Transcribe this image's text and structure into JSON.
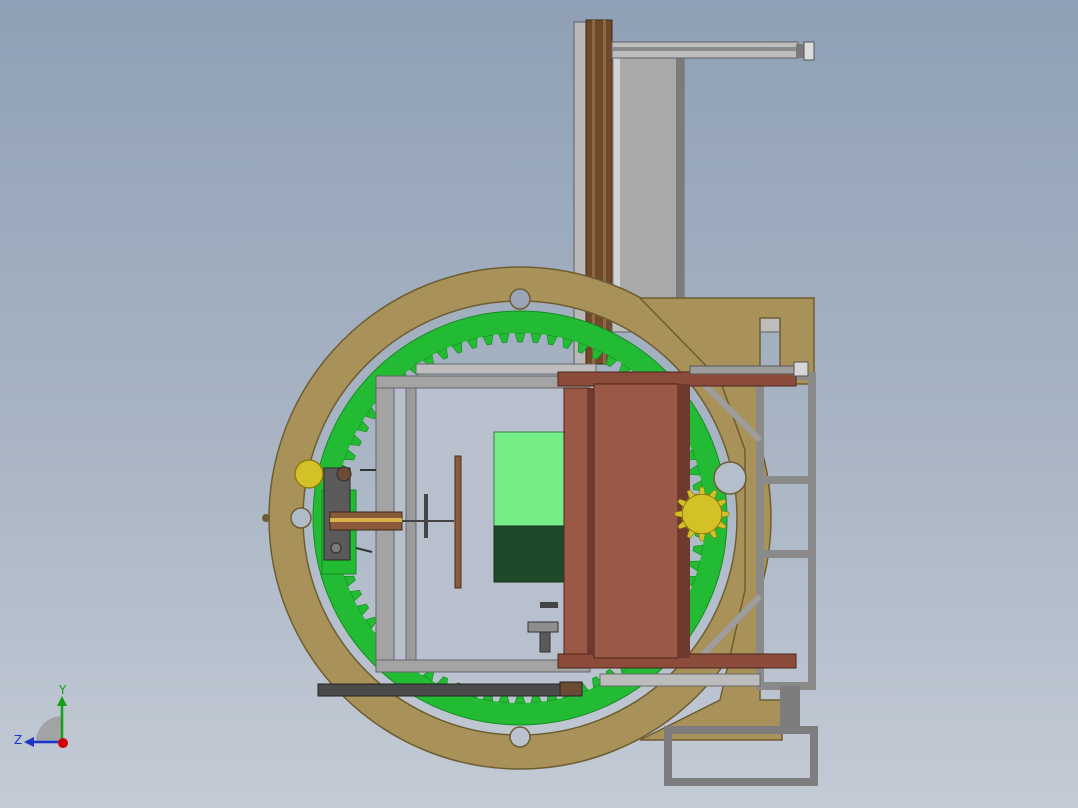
{
  "view": {
    "type": "cad-assembly-view",
    "background_top": "#8fa0b6",
    "background_bottom": "#c3cbd5"
  },
  "colors": {
    "ring_tan": "#a99259",
    "ring_tan_light": "#bca86e",
    "gear_green": "#22bb33",
    "gear_green_dark": "#178a23",
    "frame_gray": "#8e8e8e",
    "frame_light": "#c6c6c6",
    "plate_brown": "#9a5847",
    "plate_brown_dark": "#6e3a2e",
    "rail_wood": "#6f4a2a",
    "panel_light_green": "#76ee87",
    "panel_dark_green": "#1f4a2a",
    "pinion_yellow": "#d4c027",
    "axis_x": "#d10000",
    "axis_y": "#13a013",
    "axis_z": "#1a35c8"
  },
  "triad": {
    "x_label": "",
    "y_label": "Y",
    "z_label": "Z",
    "icon": "coordinate-triad-icon"
  },
  "components": [
    "outer-guide-ring",
    "green-ring-gear",
    "vertical-column",
    "brown-turnover-plate",
    "square-inner-frame",
    "clamp-assembly",
    "drive-pinion",
    "base-frame"
  ]
}
